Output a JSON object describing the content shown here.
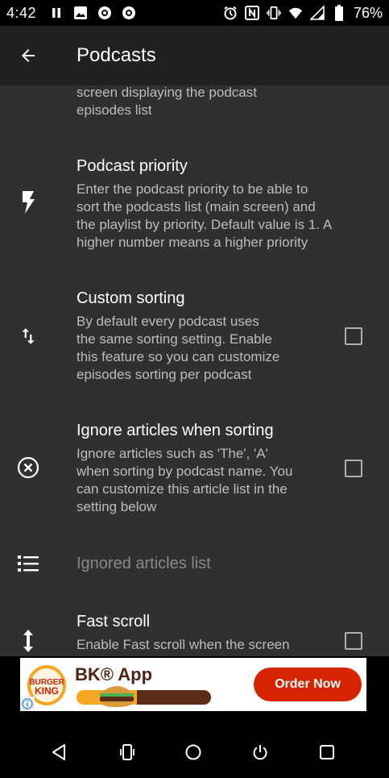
{
  "status_bar": {
    "time": "4:42",
    "battery": "76%",
    "left_icons": [
      "pause-icon",
      "image-icon",
      "app-icon",
      "app-icon"
    ],
    "right_icons": [
      "alarm-icon",
      "nfc-icon",
      "vibrate-icon",
      "wifi-icon",
      "signal-icon",
      "battery-icon"
    ]
  },
  "app_bar": {
    "title": "Podcasts"
  },
  "preferences": [
    {
      "id": "partial",
      "summary_lines": [
        "screen displaying the podcast",
        "episodes list"
      ]
    },
    {
      "id": "podcast-priority",
      "icon": "flash-icon",
      "title": "Podcast priority",
      "summary_lines": [
        "Enter the podcast priority to be able to",
        "sort the podcasts list (main screen) and",
        "the playlist by priority. Default value is 1. A",
        "higher number means a higher priority"
      ]
    },
    {
      "id": "custom-sorting",
      "icon": "sort-icon",
      "title": "Custom sorting",
      "summary_lines": [
        "By default every podcast uses",
        "the same sorting setting. Enable",
        "this feature so you can customize",
        "episodes sorting per podcast"
      ],
      "checked": false
    },
    {
      "id": "ignore-articles",
      "icon": "cancel-circle-icon",
      "title": "Ignore articles when sorting",
      "summary_lines": [
        "Ignore articles such as 'The', 'A'",
        "when sorting by podcast name. You",
        "can customize this article list in the",
        "setting below"
      ],
      "checked": false
    },
    {
      "id": "ignored-articles-list",
      "icon": "list-icon",
      "title": "Ignored articles list",
      "disabled": true
    },
    {
      "id": "fast-scroll",
      "icon": "vertical-arrows-icon",
      "title": "Fast scroll",
      "summary_lines": [
        "Enable Fast scroll when the screen"
      ],
      "checked": false
    }
  ],
  "ad": {
    "logo_text_top": "BURGER",
    "logo_text_bottom": "KING",
    "title": "BK® App",
    "cta": "Order Now",
    "colors": {
      "brand_red": "#d62300",
      "brand_brown": "#502314",
      "brand_orange": "#f5a623"
    }
  },
  "nav_bar": {
    "buttons": [
      "back-icon",
      "screenshot-icon",
      "home-icon",
      "power-icon",
      "recents-icon"
    ]
  },
  "colors": {
    "app_bar": "#212121",
    "content_bg": "#303030",
    "summary_text": "#bdbdbd"
  }
}
